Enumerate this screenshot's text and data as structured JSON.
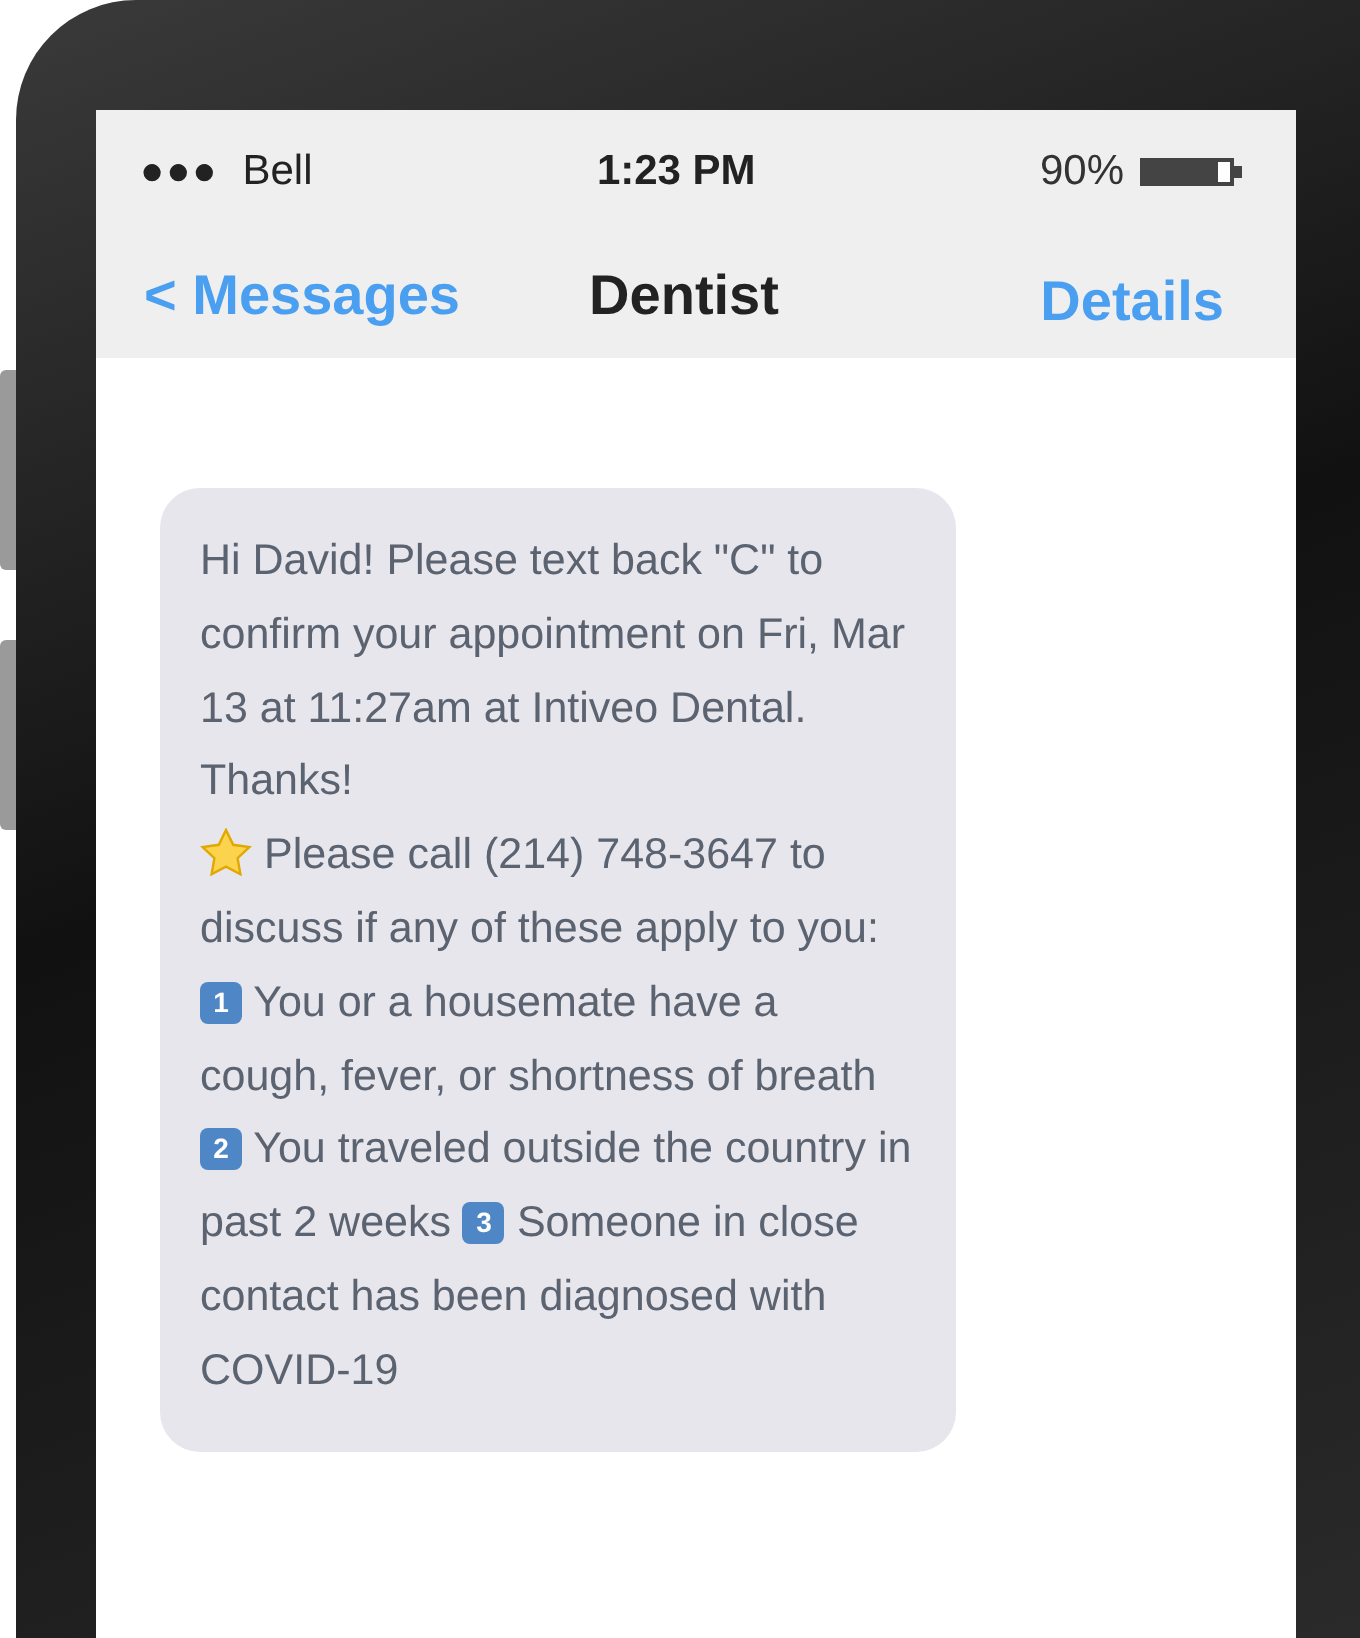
{
  "status_bar": {
    "signal": "●●●",
    "carrier": "Bell",
    "time": "1:23 PM",
    "battery": "90%"
  },
  "nav_bar": {
    "back": "< Messages",
    "title": "Dentist",
    "action": "Details"
  },
  "messages": [
    {
      "paragraphs": [
        [
          {
            "kind": "text",
            "text": "Hi David! Please text back \"C\" to confirm your appointment on Fri, Mar 13 at 11:27am at Intiveo Dental. Thanks!"
          }
        ],
        [
          {
            "kind": "star"
          },
          {
            "kind": "text",
            "text": "Please call (214) 748-3647 to discuss if any of these apply to you: "
          },
          {
            "kind": "keycap",
            "text": "1"
          },
          {
            "kind": "text",
            "text": " You or a housemate have a cough, fever, or shortness of breath "
          },
          {
            "kind": "keycap",
            "text": "2"
          },
          {
            "kind": "text",
            "text": " You traveled outside the country in past 2 weeks "
          },
          {
            "kind": "keycap",
            "text": "3"
          },
          {
            "kind": "text",
            "text": " Someone in close contact has been diagnosed with COVID-19"
          }
        ]
      ]
    }
  ]
}
